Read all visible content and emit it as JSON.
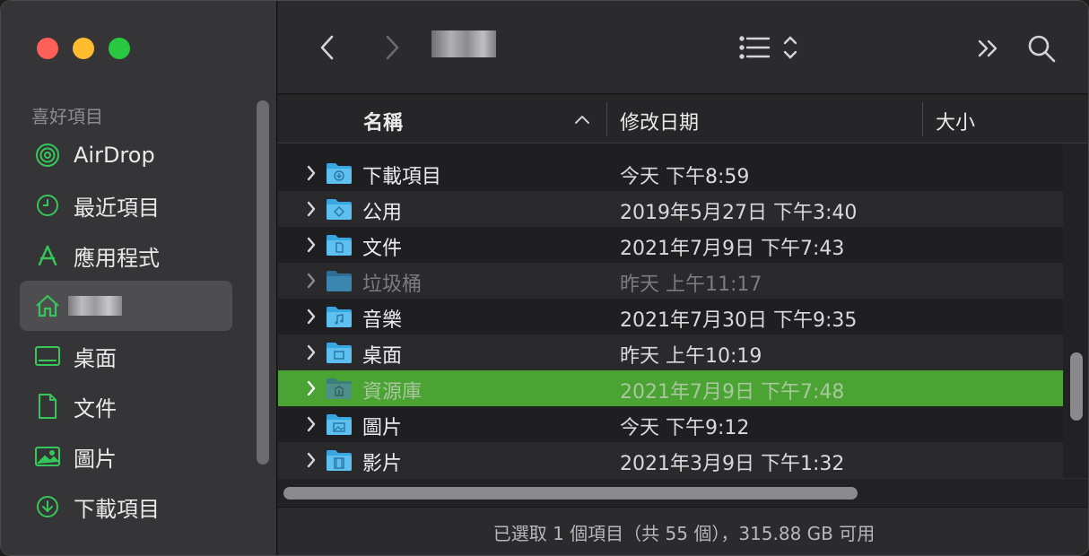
{
  "sidebar": {
    "section_label": "喜好項目",
    "items": [
      {
        "label": "AirDrop",
        "icon": "airdrop-icon"
      },
      {
        "label": "最近項目",
        "icon": "clock-icon"
      },
      {
        "label": "應用程式",
        "icon": "applications-icon"
      },
      {
        "label": "",
        "icon": "home-icon",
        "selected": true
      },
      {
        "label": "桌面",
        "icon": "desktop-icon"
      },
      {
        "label": "文件",
        "icon": "document-icon"
      },
      {
        "label": "圖片",
        "icon": "pictures-icon"
      },
      {
        "label": "下載項目",
        "icon": "download-icon"
      }
    ]
  },
  "columns": {
    "name": "名稱",
    "date": "修改日期",
    "size": "大小"
  },
  "rows": [
    {
      "name": "下載項目",
      "date": "今天 下午8:59"
    },
    {
      "name": "公用",
      "date": "2019年5月27日 下午3:40"
    },
    {
      "name": "文件",
      "date": "2021年7月9日 下午7:43"
    },
    {
      "name": "垃圾桶",
      "date": "昨天 上午11:17"
    },
    {
      "name": "音樂",
      "date": "2021年7月30日 下午9:35"
    },
    {
      "name": "桌面",
      "date": "昨天 上午10:19"
    },
    {
      "name": "資源庫",
      "date": "2021年7月9日 下午7:48"
    },
    {
      "name": "圖片",
      "date": "今天 下午9:12"
    },
    {
      "name": "影片",
      "date": "2021年3月9日 下午1:32"
    }
  ],
  "status": "已選取 1 個項目（共 55 個），315.88 GB 可用",
  "colors": {
    "accent": "#35c759",
    "selection": "#4aa332",
    "folder": "#3aa6e0"
  }
}
